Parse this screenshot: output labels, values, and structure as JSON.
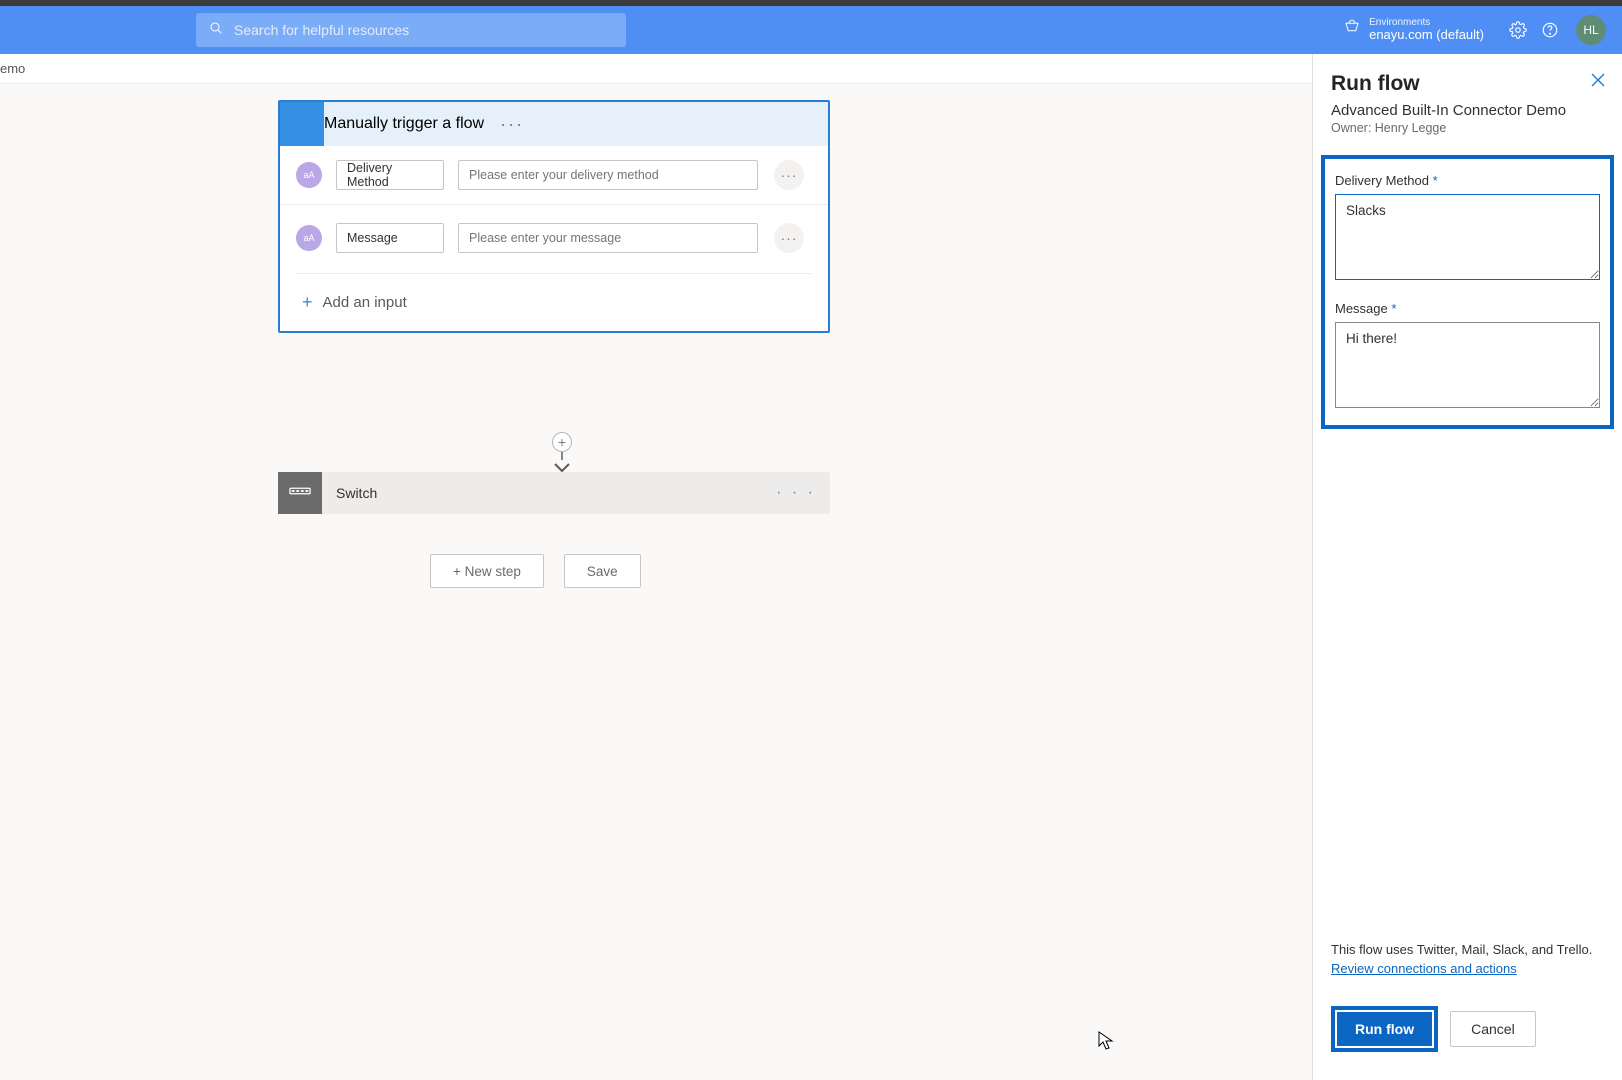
{
  "header": {
    "search_placeholder": "Search for helpful resources",
    "env_label": "Environments",
    "env_name": "enayu.com (default)",
    "avatar_initials": "HL"
  },
  "breadcrumb": "emo",
  "trigger_card": {
    "title": "Manually trigger a flow",
    "params": [
      {
        "badge": "aA",
        "label": "Delivery Method",
        "placeholder": "Please enter your delivery method"
      },
      {
        "badge": "aA",
        "label": "Message",
        "placeholder": "Please enter your message"
      }
    ],
    "add_input": "Add an input"
  },
  "switch_card": {
    "title": "Switch"
  },
  "buttons": {
    "new_step": "+ New step",
    "save": "Save"
  },
  "panel": {
    "title": "Run flow",
    "subtitle": "Advanced Built-In Connector Demo",
    "owner": "Owner: Henry Legge",
    "fields": [
      {
        "label": "Delivery Method",
        "value": "Slacks"
      },
      {
        "label": "Message",
        "value": "Hi there!"
      }
    ],
    "footer_text": "This flow uses Twitter, Mail, Slack, and Trello.",
    "footer_link": "Review connections and actions",
    "run": "Run flow",
    "cancel": "Cancel"
  }
}
